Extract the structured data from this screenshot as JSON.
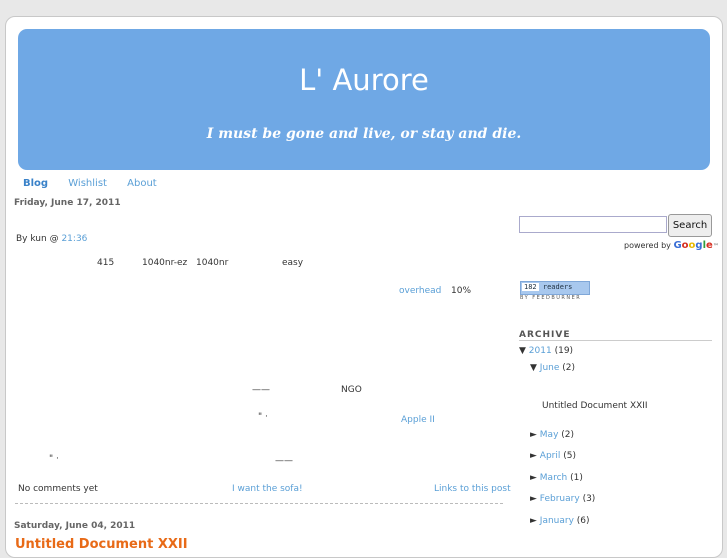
{
  "blog": {
    "title": "L' Aurore",
    "tagline": "I must be gone and live, or stay and die."
  },
  "tabs": [
    "Blog",
    "Wishlist",
    "About"
  ],
  "post1": {
    "date": "Friday, June 17, 2011",
    "byline_prefix": "By kun @",
    "time": "21:36",
    "line1": [
      "415",
      "1040nr-ez",
      "1040nr",
      "easy"
    ],
    "overhead": "overhead",
    "percent": "10%",
    "dash1": "——",
    "ngo": "NGO",
    "quote1": "\"  ·",
    "apple": "Apple II",
    "quote2": "\"  ·",
    "dash2": "——",
    "comments": "No comments yet",
    "sofa": "I want the sofa!",
    "links": "Links to this post"
  },
  "post2": {
    "date": "Saturday, June 04, 2011",
    "title": "Untitled Document XXII"
  },
  "sidebar": {
    "search_label": "Search",
    "powered_by": "powered by",
    "google": "Google™",
    "readers_count": "182",
    "readers_label": "readers",
    "by_feedburner": "BY FEEDBURNER",
    "archive_heading": "ARCHIVE",
    "archive": {
      "year": "2011",
      "year_count": "(19)",
      "current_month": "June",
      "current_count": "(2)",
      "current_post": "Untitled Document XXII",
      "months": [
        {
          "name": "May",
          "count": "(2)"
        },
        {
          "name": "April",
          "count": "(5)"
        },
        {
          "name": "March",
          "count": "(1)"
        },
        {
          "name": "February",
          "count": "(3)"
        },
        {
          "name": "January",
          "count": "(6)"
        }
      ]
    }
  },
  "colors": {
    "header_bg": "#6fa8e5",
    "link": "#5a9fd6",
    "post_title": "#e86a17"
  }
}
